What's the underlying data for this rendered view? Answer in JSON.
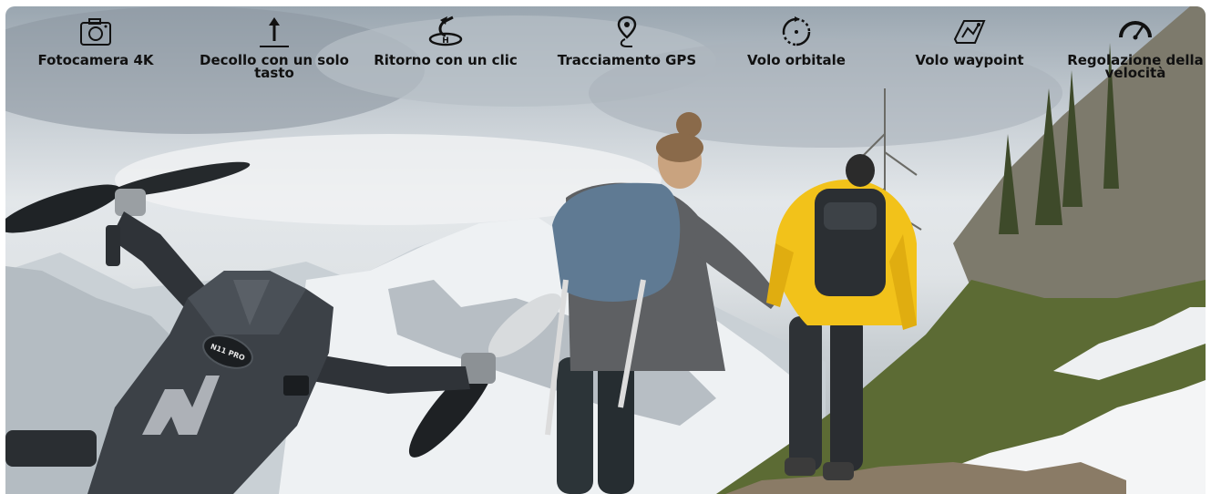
{
  "features": [
    {
      "icon": "camera-icon",
      "label": "Fotocamera 4K"
    },
    {
      "icon": "takeoff-icon",
      "label": "Decollo con un solo tasto"
    },
    {
      "icon": "return-home-icon",
      "label": "Ritorno con un clic"
    },
    {
      "icon": "gps-pin-icon",
      "label": "Tracciamento GPS"
    },
    {
      "icon": "orbit-icon",
      "label": "Volo orbitale"
    },
    {
      "icon": "waypoint-icon",
      "label": "Volo waypoint"
    },
    {
      "icon": "speedometer-icon",
      "label": "Regolazione della velocità"
    }
  ],
  "drone": {
    "model_label": "N11 PRO",
    "brand_mark": "N"
  },
  "colors": {
    "jacket": "#f2c21a",
    "backpack_left": "#5f7a93",
    "backpack_right": "#2b2f33"
  }
}
